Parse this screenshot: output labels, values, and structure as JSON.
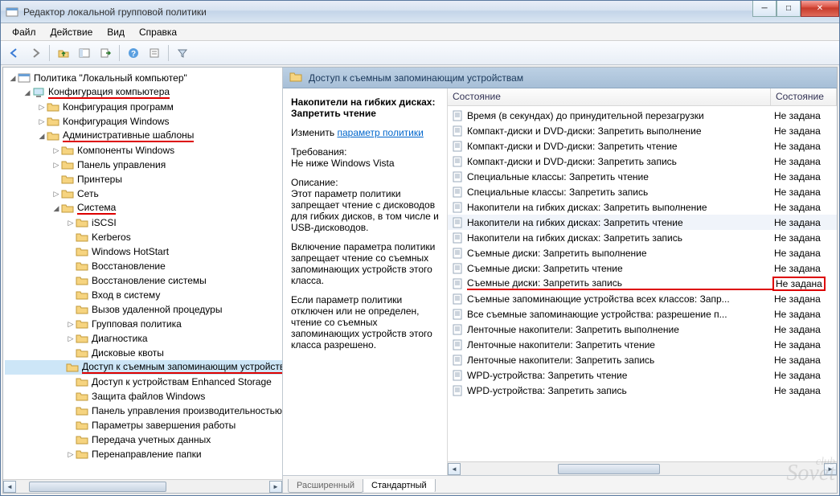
{
  "window": {
    "title": "Редактор локальной групповой политики"
  },
  "menu": {
    "file": "Файл",
    "action": "Действие",
    "view": "Вид",
    "help": "Справка"
  },
  "tree": {
    "root": "Политика \"Локальный компьютер\"",
    "comp_config": "Конфигурация компьютера",
    "prog_config": "Конфигурация программ",
    "win_config": "Конфигурация Windows",
    "admin_templates": "Административные шаблоны",
    "win_components": "Компоненты Windows",
    "control_panel": "Панель управления",
    "printers": "Принтеры",
    "network": "Сеть",
    "system": "Система",
    "iscsi": "iSCSI",
    "kerberos": "Kerberos",
    "hotstart": "Windows HotStart",
    "recovery": "Восстановление",
    "sys_recovery": "Восстановление системы",
    "logon": "Вход в систему",
    "rpc": "Вызов удаленной процедуры",
    "group_policy": "Групповая политика",
    "diagnostics": "Диагностика",
    "disk_quotas": "Дисковые квоты",
    "removable_access": "Доступ к съемным запоминающим устройствам",
    "enhanced_storage": "Доступ к устройствам Enhanced Storage",
    "file_protection": "Защита файлов Windows",
    "perf_panel": "Панель управления производительностью",
    "shutdown_params": "Параметры завершения работы",
    "cred_delegation": "Передача учетных данных",
    "folder_redirect": "Перенаправление папки"
  },
  "right": {
    "header": "Доступ к съемным запоминающим устройствам",
    "policy_title": "Накопители на гибких дисках: Запретить чтение",
    "edit_label": "Изменить",
    "edit_link": "параметр политики",
    "req_label": "Требования:",
    "req_value": "Не ниже Windows Vista",
    "desc_label": "Описание:",
    "desc_p1": "Этот параметр политики запрещает чтение с дисководов для гибких дисков, в том числе и USB-дисководов.",
    "desc_p2": "Включение параметра политики запрещает чтение со съемных запоминающих устройств этого класса.",
    "desc_p3": "Если параметр политики отключен или не определен, чтение со съемных запоминающих устройств этого класса разрешено.",
    "col_state": "Состояние",
    "col_state2": "Состояние",
    "state_not_set": "Не задана"
  },
  "policies": [
    {
      "name": "Время (в секундах) до принудительной перезагрузки",
      "state": "Не задана"
    },
    {
      "name": "Компакт-диски и DVD-диски: Запретить выполнение",
      "state": "Не задана"
    },
    {
      "name": "Компакт-диски и DVD-диски: Запретить чтение",
      "state": "Не задана"
    },
    {
      "name": "Компакт-диски и DVD-диски: Запретить запись",
      "state": "Не задана"
    },
    {
      "name": "Специальные классы: Запретить чтение",
      "state": "Не задана"
    },
    {
      "name": "Специальные классы: Запретить запись",
      "state": "Не задана"
    },
    {
      "name": "Накопители на гибких дисках: Запретить выполнение",
      "state": "Не задана"
    },
    {
      "name": "Накопители на гибких дисках: Запретить чтение",
      "state": "Не задана",
      "selected": true
    },
    {
      "name": "Накопители на гибких дисках: Запретить запись",
      "state": "Не задана"
    },
    {
      "name": "Съемные диски: Запретить выполнение",
      "state": "Не задана"
    },
    {
      "name": "Съемные диски: Запретить чтение",
      "state": "Не задана"
    },
    {
      "name": "Съемные диски: Запретить запись",
      "state": "Не задана",
      "hl": true
    },
    {
      "name": "Съемные запоминающие устройства всех классов: Запр...",
      "state": "Не задана"
    },
    {
      "name": "Все съемные запоминающие устройства: разрешение п...",
      "state": "Не задана"
    },
    {
      "name": "Ленточные накопители: Запретить выполнение",
      "state": "Не задана"
    },
    {
      "name": "Ленточные накопители: Запретить чтение",
      "state": "Не задана"
    },
    {
      "name": "Ленточные накопители: Запретить запись",
      "state": "Не задана"
    },
    {
      "name": "WPD-устройства: Запретить чтение",
      "state": "Не задана"
    },
    {
      "name": "WPD-устройства: Запретить запись",
      "state": "Не задана"
    }
  ],
  "tabs": {
    "extended": "Расширенный",
    "standard": "Стандартный"
  },
  "watermark": {
    "top": "club",
    "bottom": "Sovet"
  }
}
